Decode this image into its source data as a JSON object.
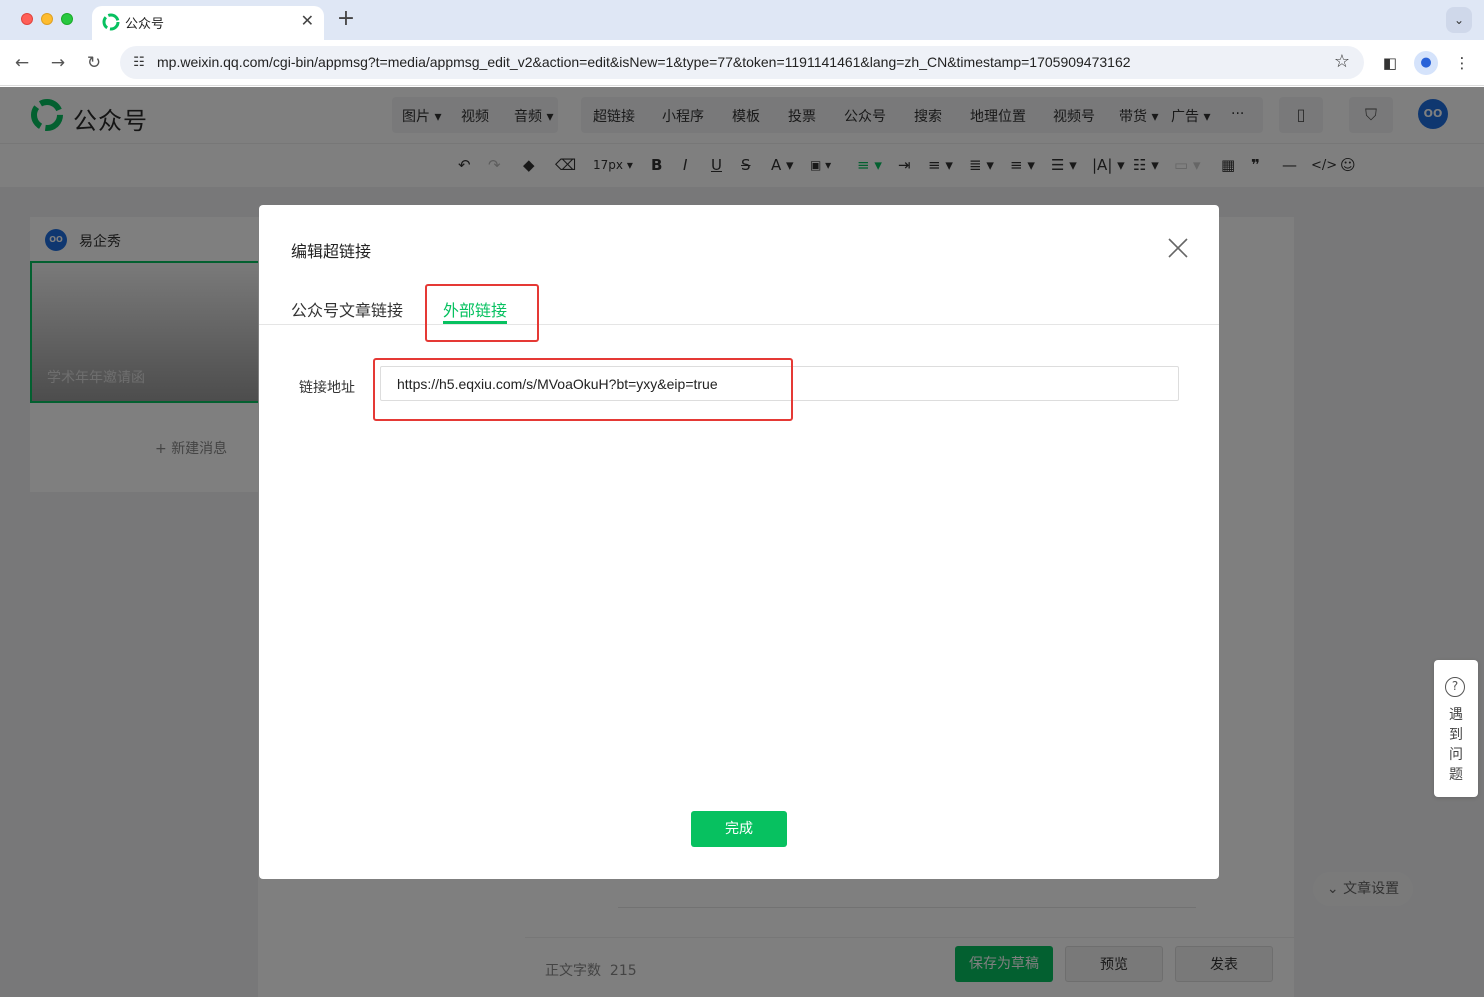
{
  "browser": {
    "tab_title": "公众号",
    "url": "mp.weixin.qq.com/cgi-bin/appmsg?t=media/appmsg_edit_v2&action=edit&isNew=1&type=77&token=1191141461&lang=zh_CN&timestamp=1705909473162"
  },
  "header": {
    "logo_text": "公众号",
    "menu_items": [
      "图片",
      "视频",
      "音频",
      "超链接",
      "小程序",
      "模板",
      "投票",
      "公众号",
      "搜索",
      "地理位置",
      "视频号",
      "带货",
      "广告",
      "···"
    ]
  },
  "format_toolbar": {
    "font_size": "17px"
  },
  "sidebar": {
    "account_name": "易企秀",
    "article_title": "学术年年邀请函",
    "new_message_label": "新建消息"
  },
  "bottom_bar": {
    "word_count_label": "正文字数",
    "word_count": "215",
    "save_draft_label": "保存为草稿",
    "preview_label": "预览",
    "publish_label": "发表"
  },
  "article_settings_label": "文章设置",
  "help_widget": {
    "label": "遇到问题"
  },
  "dialog": {
    "title": "编辑超链接",
    "tabs": [
      "公众号文章链接",
      "外部链接"
    ],
    "active_tab": 1,
    "field_label": "链接地址",
    "link_value": "https://h5.eqxiu.com/s/MVoaOkuH?bt=yxy&eip=true",
    "done_label": "完成"
  },
  "colors": {
    "accent_green": "#07c160",
    "highlight_red": "#e53935"
  }
}
